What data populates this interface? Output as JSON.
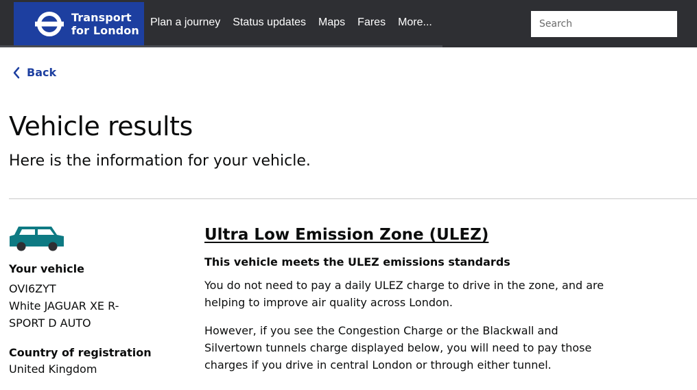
{
  "header": {
    "logo_line1": "Transport",
    "logo_line2": "for London",
    "nav": [
      "Plan a journey",
      "Status updates",
      "Maps",
      "Fares",
      "More..."
    ],
    "search_placeholder": "Search"
  },
  "back_label": "Back",
  "page": {
    "title": "Vehicle results",
    "subtitle": "Here is the information for your vehicle."
  },
  "vehicle": {
    "your_vehicle_label": "Your vehicle",
    "registration": "OVI6ZYT",
    "description_line1": "White JAGUAR XE R-",
    "description_line2": "SPORT D AUTO",
    "country_label": "Country of registration",
    "country": "United Kingdom"
  },
  "ulez": {
    "title": "Ultra Low Emission Zone (ULEZ)",
    "status": "This vehicle meets the ULEZ emissions standards",
    "para1_line1": "You do not need to pay a daily ULEZ charge to drive in the zone, and are",
    "para1_line2": "helping to improve air quality across London.",
    "para2_line1": "However, if you see the Congestion Charge or the Blackwall and",
    "para2_line2": "Silvertown tunnels charge displayed below, you will need to pay those",
    "para2_line3": "charges if you drive in central London or through either tunnel."
  },
  "colors": {
    "header_bg": "#2e2f33",
    "logo_bg": "#1d3fa0",
    "link": "#1d3fa0",
    "car": "#0e7a83"
  },
  "icons": {
    "roundel": "tfl-roundel-icon",
    "back": "chevron-left-icon",
    "car": "car-icon"
  }
}
